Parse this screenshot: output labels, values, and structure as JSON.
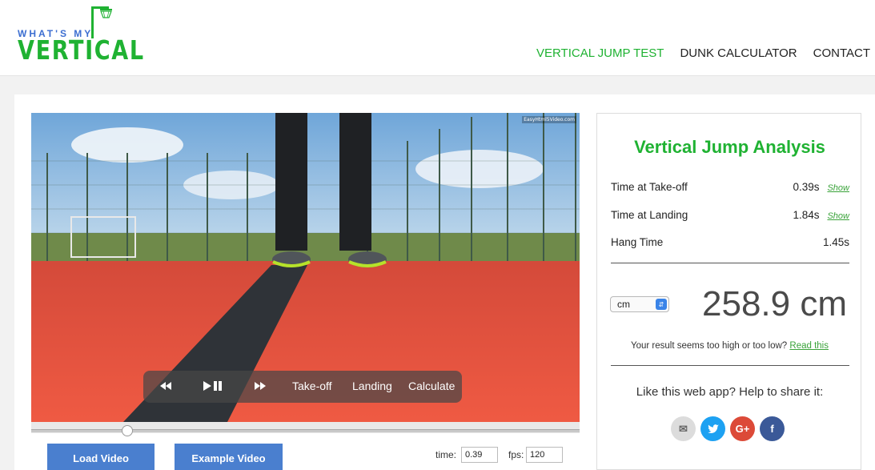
{
  "header": {
    "logo_top": "WHAT'S MY",
    "logo_main": "VERTICAL",
    "nav": [
      "VERTICAL JUMP TEST",
      "DUNK CALCULATOR",
      "CONTACT"
    ]
  },
  "video": {
    "watermark": "EasyHtml5Video.com",
    "controls": {
      "takeoff": "Take-off",
      "landing": "Landing",
      "calculate": "Calculate"
    },
    "seek_position": 0.175
  },
  "buttons": {
    "load": "Load Video",
    "example": "Example Video"
  },
  "fields": {
    "time_label": "time:",
    "time_value": "0.39",
    "fps_label": "fps:",
    "fps_value": "120"
  },
  "analysis": {
    "title": "Vertical Jump Analysis",
    "takeoff_label": "Time at Take-off",
    "takeoff_value": "0.39s",
    "landing_label": "Time at Landing",
    "landing_value": "1.84s",
    "hang_label": "Hang Time",
    "hang_value": "1.45s",
    "show_label": "Show",
    "unit": "cm",
    "result": "258.9 cm",
    "note": "Your result seems too high or too low?",
    "note_link": "Read this",
    "share_text": "Like this web app? Help to share it:"
  },
  "colors": {
    "brand_green": "#1fb232",
    "button_blue": "#4a7fcf",
    "track_red": "#e0533f"
  },
  "icons": [
    "basketball-hoop-icon",
    "rewind-icon",
    "play-pause-icon",
    "fast-forward-icon",
    "select-arrows-icon",
    "email-icon",
    "twitter-icon",
    "google-plus-icon",
    "facebook-icon"
  ]
}
